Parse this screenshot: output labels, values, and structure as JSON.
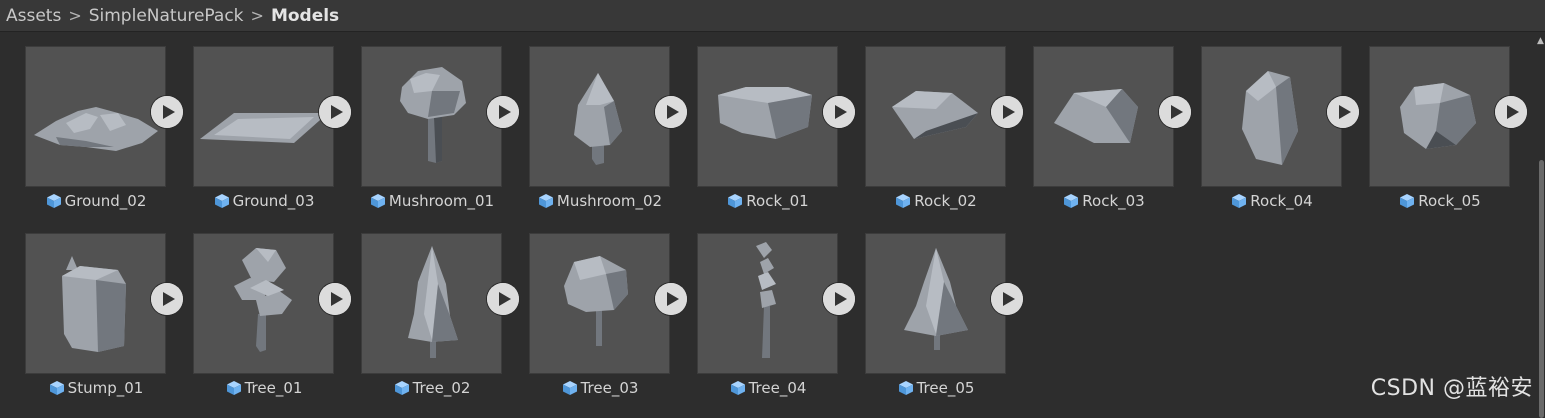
{
  "breadcrumb": [
    {
      "label": "Assets"
    },
    {
      "label": "SimpleNaturePack"
    },
    {
      "label": "Models"
    }
  ],
  "breadcrumb_separator": ">",
  "assets": [
    {
      "name": "Ground_02",
      "icon": "mesh-icon",
      "preview": "ground-bumpy"
    },
    {
      "name": "Ground_03",
      "icon": "mesh-icon",
      "preview": "ground-flat"
    },
    {
      "name": "Mushroom_01",
      "icon": "mesh-icon",
      "preview": "mushroom-round"
    },
    {
      "name": "Mushroom_02",
      "icon": "mesh-icon",
      "preview": "mushroom-cone"
    },
    {
      "name": "Rock_01",
      "icon": "mesh-icon",
      "preview": "rock-flat-wide"
    },
    {
      "name": "Rock_02",
      "icon": "mesh-icon",
      "preview": "rock-slab"
    },
    {
      "name": "Rock_03",
      "icon": "mesh-icon",
      "preview": "rock-angular"
    },
    {
      "name": "Rock_04",
      "icon": "mesh-icon",
      "preview": "rock-tall"
    },
    {
      "name": "Rock_05",
      "icon": "mesh-icon",
      "preview": "rock-round"
    },
    {
      "name": "Stump_01",
      "icon": "mesh-icon",
      "preview": "stump"
    },
    {
      "name": "Tree_01",
      "icon": "mesh-icon",
      "preview": "tree-bushy"
    },
    {
      "name": "Tree_02",
      "icon": "mesh-icon",
      "preview": "tree-pine-tall"
    },
    {
      "name": "Tree_03",
      "icon": "mesh-icon",
      "preview": "tree-round"
    },
    {
      "name": "Tree_04",
      "icon": "mesh-icon",
      "preview": "tree-thin"
    },
    {
      "name": "Tree_05",
      "icon": "mesh-icon",
      "preview": "tree-pine"
    }
  ],
  "play_icon": "play-icon",
  "watermark": "CSDN @蓝裕安",
  "colors": {
    "background": "#2d2d2d",
    "toolbar": "#383838",
    "thumbnail": "#525252",
    "mesh_icon": "#6fb2f0"
  }
}
